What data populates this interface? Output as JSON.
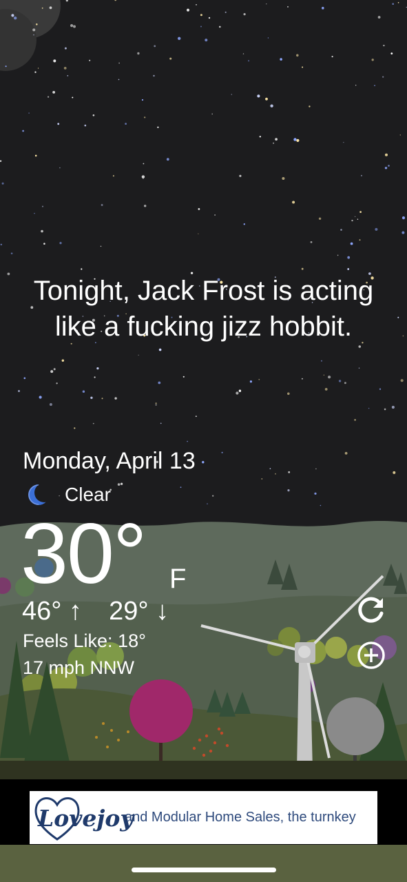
{
  "headline": "Tonight, Jack Frost is acting like a fucking jizz hobbit.",
  "weather": {
    "date": "Monday, April 13",
    "condition": "Clear",
    "condition_icon": "crescent-moon-icon",
    "temperature": "30°",
    "unit": "F",
    "high": "46°",
    "low": "29°",
    "high_arrow": "↑",
    "low_arrow": "↓",
    "feels_like": "Feels Like: 18°",
    "wind": "17 mph NNW"
  },
  "actions": {
    "refresh_icon": "refresh-icon",
    "add_icon": "add-location-icon"
  },
  "ad": {
    "logo_text": "Lovejoy",
    "text": "and Modular Home Sales, the turnkey"
  },
  "colors": {
    "sky": "#1c1c1e",
    "moon": "#3b6fd6",
    "hills_far": "#5e6b5c",
    "hills_near": "#4d5a3a",
    "ad_text": "#2e4a7c"
  }
}
